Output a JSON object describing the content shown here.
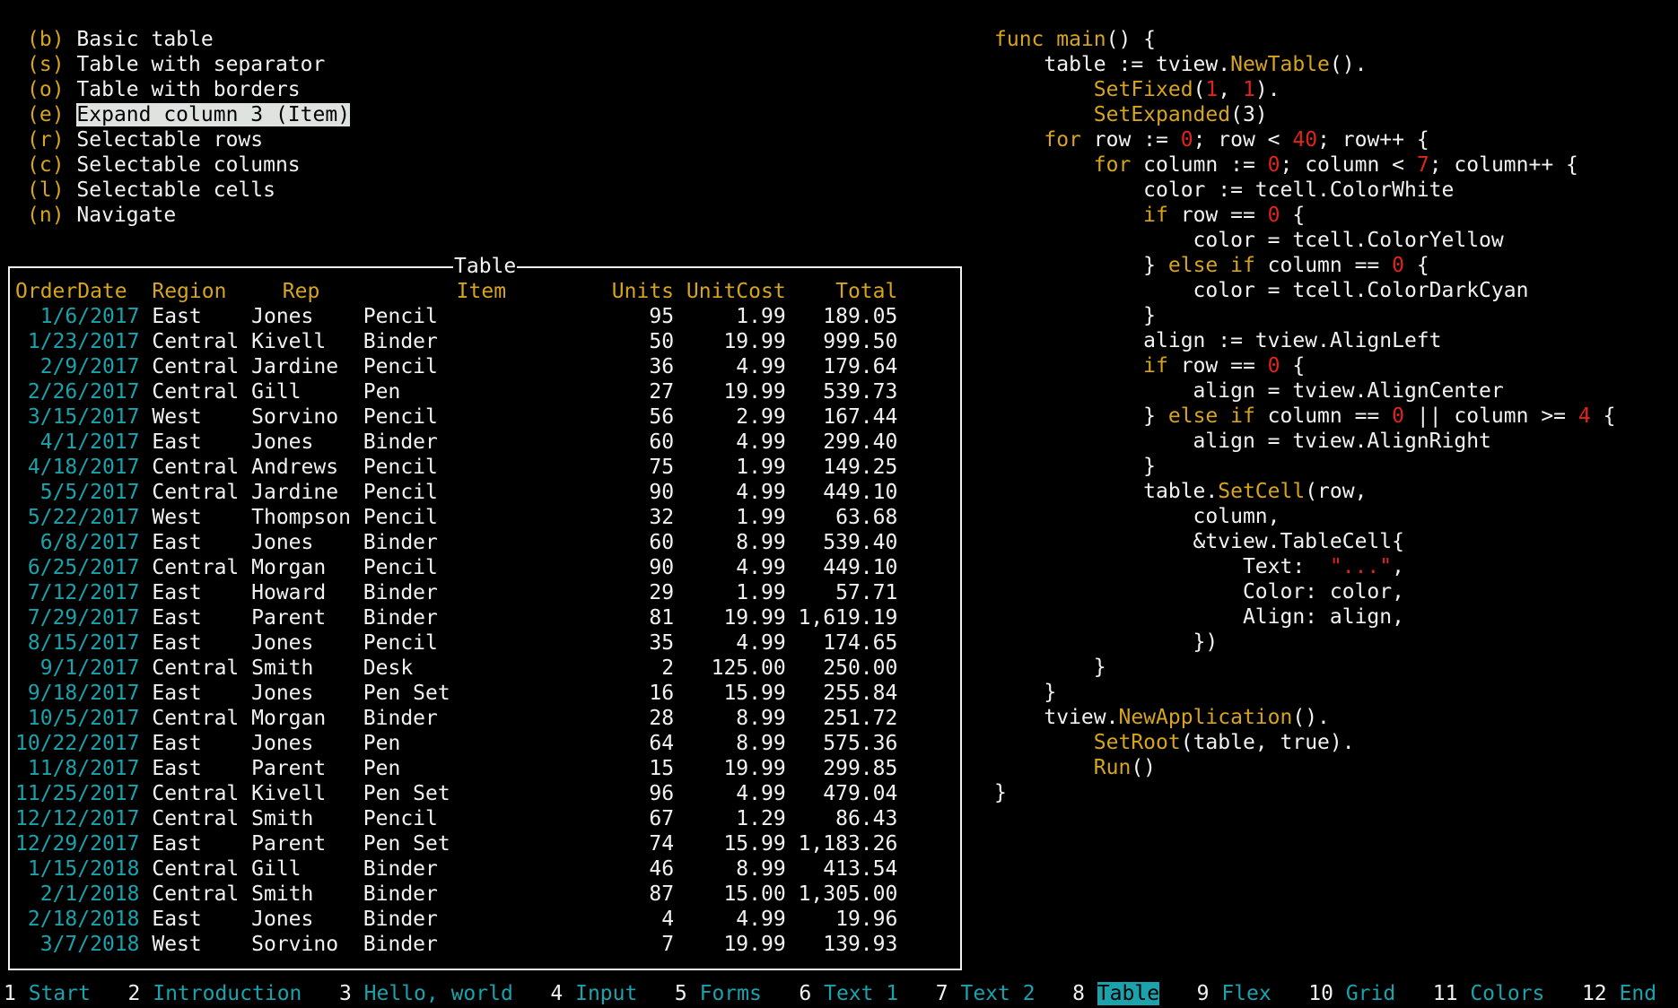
{
  "menu": [
    {
      "key": "(b)",
      "label": "Basic table",
      "selected": false
    },
    {
      "key": "(s)",
      "label": "Table with separator",
      "selected": false
    },
    {
      "key": "(o)",
      "label": "Table with borders",
      "selected": false
    },
    {
      "key": "(e)",
      "label": "Expand column 3 (Item)",
      "selected": true
    },
    {
      "key": "(r)",
      "label": "Selectable rows",
      "selected": false
    },
    {
      "key": "(c)",
      "label": "Selectable columns",
      "selected": false
    },
    {
      "key": "(l)",
      "label": "Selectable cells",
      "selected": false
    },
    {
      "key": "(n)",
      "label": "Navigate",
      "selected": false
    }
  ],
  "table": {
    "title": "Table",
    "headers": [
      "OrderDate",
      "Region",
      "Rep",
      "Item",
      "Units",
      "UnitCost",
      "Total"
    ],
    "rows": [
      [
        "1/6/2017",
        "East",
        "Jones",
        "Pencil",
        "95",
        "1.99",
        "189.05"
      ],
      [
        "1/23/2017",
        "Central",
        "Kivell",
        "Binder",
        "50",
        "19.99",
        "999.50"
      ],
      [
        "2/9/2017",
        "Central",
        "Jardine",
        "Pencil",
        "36",
        "4.99",
        "179.64"
      ],
      [
        "2/26/2017",
        "Central",
        "Gill",
        "Pen",
        "27",
        "19.99",
        "539.73"
      ],
      [
        "3/15/2017",
        "West",
        "Sorvino",
        "Pencil",
        "56",
        "2.99",
        "167.44"
      ],
      [
        "4/1/2017",
        "East",
        "Jones",
        "Binder",
        "60",
        "4.99",
        "299.40"
      ],
      [
        "4/18/2017",
        "Central",
        "Andrews",
        "Pencil",
        "75",
        "1.99",
        "149.25"
      ],
      [
        "5/5/2017",
        "Central",
        "Jardine",
        "Pencil",
        "90",
        "4.99",
        "449.10"
      ],
      [
        "5/22/2017",
        "West",
        "Thompson",
        "Pencil",
        "32",
        "1.99",
        "63.68"
      ],
      [
        "6/8/2017",
        "East",
        "Jones",
        "Binder",
        "60",
        "8.99",
        "539.40"
      ],
      [
        "6/25/2017",
        "Central",
        "Morgan",
        "Pencil",
        "90",
        "4.99",
        "449.10"
      ],
      [
        "7/12/2017",
        "East",
        "Howard",
        "Binder",
        "29",
        "1.99",
        "57.71"
      ],
      [
        "7/29/2017",
        "East",
        "Parent",
        "Binder",
        "81",
        "19.99",
        "1,619.19"
      ],
      [
        "8/15/2017",
        "East",
        "Jones",
        "Pencil",
        "35",
        "4.99",
        "174.65"
      ],
      [
        "9/1/2017",
        "Central",
        "Smith",
        "Desk",
        "2",
        "125.00",
        "250.00"
      ],
      [
        "9/18/2017",
        "East",
        "Jones",
        "Pen Set",
        "16",
        "15.99",
        "255.84"
      ],
      [
        "10/5/2017",
        "Central",
        "Morgan",
        "Binder",
        "28",
        "8.99",
        "251.72"
      ],
      [
        "10/22/2017",
        "East",
        "Jones",
        "Pen",
        "64",
        "8.99",
        "575.36"
      ],
      [
        "11/8/2017",
        "East",
        "Parent",
        "Pen",
        "15",
        "19.99",
        "299.85"
      ],
      [
        "11/25/2017",
        "Central",
        "Kivell",
        "Pen Set",
        "96",
        "4.99",
        "479.04"
      ],
      [
        "12/12/2017",
        "Central",
        "Smith",
        "Pencil",
        "67",
        "1.29",
        "86.43"
      ],
      [
        "12/29/2017",
        "East",
        "Parent",
        "Pen Set",
        "74",
        "15.99",
        "1,183.26"
      ],
      [
        "1/15/2018",
        "Central",
        "Gill",
        "Binder",
        "46",
        "8.99",
        "413.54"
      ],
      [
        "2/1/2018",
        "Central",
        "Smith",
        "Binder",
        "87",
        "15.00",
        "1,305.00"
      ],
      [
        "2/18/2018",
        "East",
        "Jones",
        "Binder",
        "4",
        "4.99",
        "19.96"
      ],
      [
        "3/7/2018",
        "West",
        "Sorvino",
        "Binder",
        "7",
        "19.99",
        "139.93"
      ]
    ]
  },
  "code": [
    [
      [
        "y",
        "func "
      ],
      [
        "y",
        "main"
      ],
      [
        "w",
        "() {"
      ]
    ],
    [
      [
        "w",
        "    table := tview."
      ],
      [
        "y",
        "NewTable"
      ],
      [
        "w",
        "()."
      ]
    ],
    [
      [
        "w",
        "        "
      ],
      [
        "y",
        "SetFixed"
      ],
      [
        "w",
        "("
      ],
      [
        "r",
        "1"
      ],
      [
        "w",
        ", "
      ],
      [
        "r",
        "1"
      ],
      [
        "w",
        ")."
      ]
    ],
    [
      [
        "w",
        "        "
      ],
      [
        "y",
        "SetExpanded"
      ],
      [
        "w",
        "(3)"
      ]
    ],
    [
      [
        "w",
        "    "
      ],
      [
        "y",
        "for"
      ],
      [
        "w",
        " row := "
      ],
      [
        "r",
        "0"
      ],
      [
        "w",
        "; row < "
      ],
      [
        "r",
        "40"
      ],
      [
        "w",
        "; row++ {"
      ]
    ],
    [
      [
        "w",
        "        "
      ],
      [
        "y",
        "for"
      ],
      [
        "w",
        " column := "
      ],
      [
        "r",
        "0"
      ],
      [
        "w",
        "; column < "
      ],
      [
        "r",
        "7"
      ],
      [
        "w",
        "; column++ {"
      ]
    ],
    [
      [
        "w",
        "            color := tcell.ColorWhite"
      ]
    ],
    [
      [
        "w",
        "            "
      ],
      [
        "y",
        "if"
      ],
      [
        "w",
        " row == "
      ],
      [
        "r",
        "0"
      ],
      [
        "w",
        " {"
      ]
    ],
    [
      [
        "w",
        "                color = tcell.ColorYellow"
      ]
    ],
    [
      [
        "w",
        "            } "
      ],
      [
        "y",
        "else if"
      ],
      [
        "w",
        " column == "
      ],
      [
        "r",
        "0"
      ],
      [
        "w",
        " {"
      ]
    ],
    [
      [
        "w",
        "                color = tcell.ColorDarkCyan"
      ]
    ],
    [
      [
        "w",
        "            }"
      ]
    ],
    [
      [
        "w",
        "            align := tview.AlignLeft"
      ]
    ],
    [
      [
        "w",
        "            "
      ],
      [
        "y",
        "if"
      ],
      [
        "w",
        " row == "
      ],
      [
        "r",
        "0"
      ],
      [
        "w",
        " {"
      ]
    ],
    [
      [
        "w",
        "                align = tview.AlignCenter"
      ]
    ],
    [
      [
        "w",
        "            } "
      ],
      [
        "y",
        "else if"
      ],
      [
        "w",
        " column == "
      ],
      [
        "r",
        "0"
      ],
      [
        "w",
        " || column >= "
      ],
      [
        "r",
        "4"
      ],
      [
        "w",
        " {"
      ]
    ],
    [
      [
        "w",
        "                align = tview.AlignRight"
      ]
    ],
    [
      [
        "w",
        "            }"
      ]
    ],
    [
      [
        "w",
        "            table."
      ],
      [
        "y",
        "SetCell"
      ],
      [
        "w",
        "(row,"
      ]
    ],
    [
      [
        "w",
        "                column,"
      ]
    ],
    [
      [
        "w",
        "                &tview.TableCell{"
      ]
    ],
    [
      [
        "w",
        "                    Text:  "
      ],
      [
        "r",
        "\"...\""
      ],
      [
        "w",
        ","
      ]
    ],
    [
      [
        "w",
        "                    Color: color,"
      ]
    ],
    [
      [
        "w",
        "                    Align: align,"
      ]
    ],
    [
      [
        "w",
        "                })"
      ]
    ],
    [
      [
        "w",
        "        }"
      ]
    ],
    [
      [
        "w",
        "    }"
      ]
    ],
    [
      [
        "w",
        "    tview."
      ],
      [
        "y",
        "NewApplication"
      ],
      [
        "w",
        "()."
      ]
    ],
    [
      [
        "w",
        "        "
      ],
      [
        "y",
        "SetRoot"
      ],
      [
        "w",
        "(table, true)."
      ]
    ],
    [
      [
        "w",
        "        "
      ],
      [
        "y",
        "Run"
      ],
      [
        "w",
        "()"
      ]
    ],
    [
      [
        "w",
        "}"
      ]
    ]
  ],
  "tabs": [
    {
      "num": "1",
      "label": "Start",
      "active": false
    },
    {
      "num": "2",
      "label": "Introduction",
      "active": false
    },
    {
      "num": "3",
      "label": "Hello, world",
      "active": false
    },
    {
      "num": "4",
      "label": "Input",
      "active": false
    },
    {
      "num": "5",
      "label": "Forms",
      "active": false
    },
    {
      "num": "6",
      "label": "Text 1",
      "active": false
    },
    {
      "num": "7",
      "label": "Text 2",
      "active": false
    },
    {
      "num": "8",
      "label": "Table",
      "active": true
    },
    {
      "num": "9",
      "label": "Flex",
      "active": false
    },
    {
      "num": "10",
      "label": "Grid",
      "active": false
    },
    {
      "num": "11",
      "label": "Colors",
      "active": false
    },
    {
      "num": "12",
      "label": "End",
      "active": false
    }
  ],
  "colors": {
    "header": "#d7a41e",
    "first_column": "#1aa3ad",
    "default_text": "#f2f2f2",
    "selected_menu_bg": "#dfe3e0",
    "active_tab_bg": "#1aa3ad",
    "code_literal": "#e0241c"
  }
}
